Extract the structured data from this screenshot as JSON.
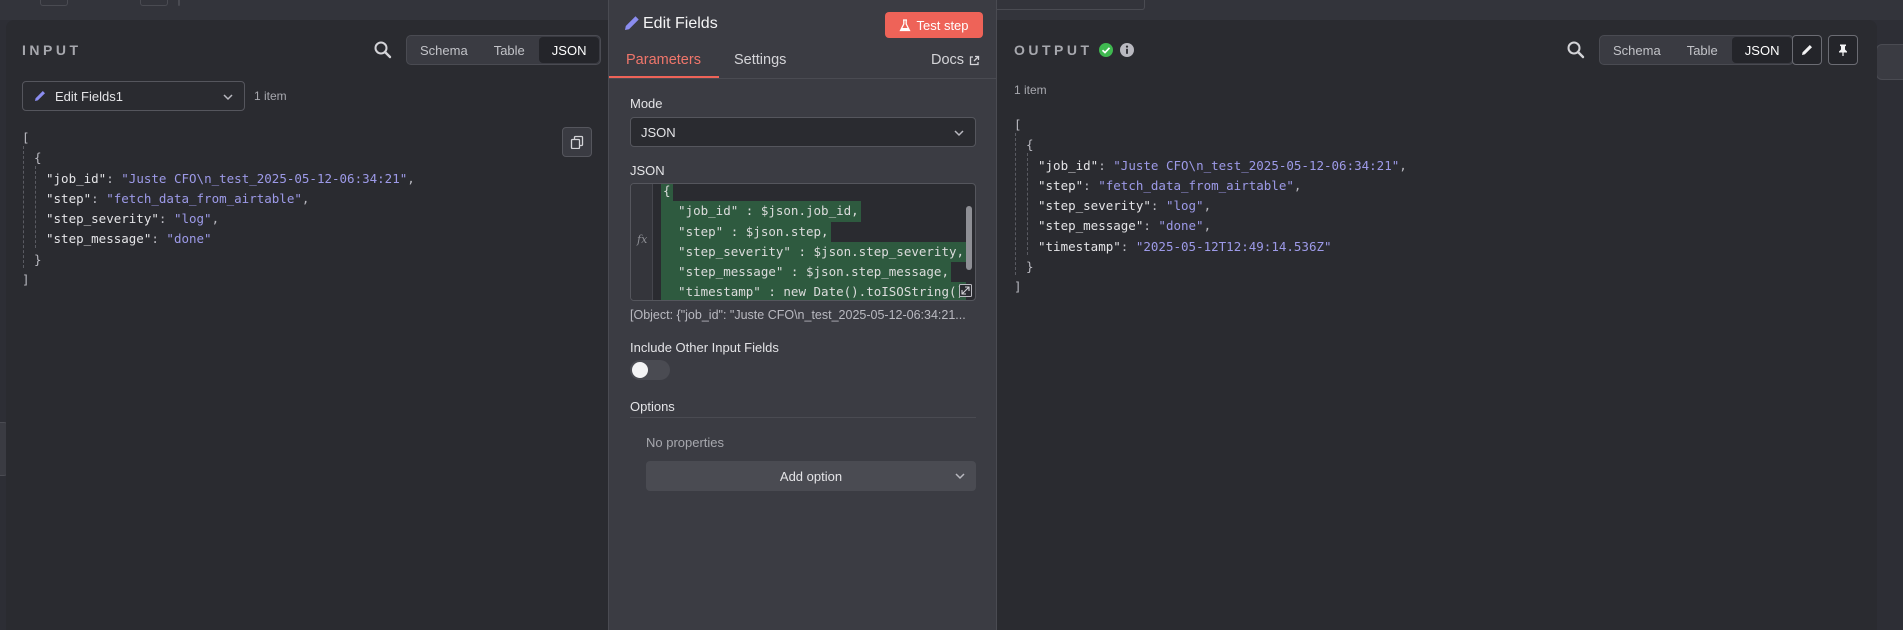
{
  "input": {
    "title": "INPUT",
    "view_modes": [
      "Schema",
      "Table",
      "JSON"
    ],
    "active_mode": "JSON",
    "node_select": "Edit Fields1",
    "item_count": "1 item",
    "json": {
      "open_array": "[",
      "open_obj": "{",
      "fields": [
        {
          "key": "\"job_id\"",
          "value": "\"Juste CFO\\n_test_2025-05-12-06:34:21\"",
          "comma": true
        },
        {
          "key": "\"step\"",
          "value": "\"fetch_data_from_airtable\"",
          "comma": true
        },
        {
          "key": "\"step_severity\"",
          "value": "\"log\"",
          "comma": true
        },
        {
          "key": "\"step_message\"",
          "value": "\"done\"",
          "comma": false
        }
      ],
      "close_obj": "}",
      "close_array": "]"
    }
  },
  "node": {
    "title": "Edit Fields",
    "test_button": "Test step",
    "tabs": [
      "Parameters",
      "Settings"
    ],
    "docs_link": "Docs",
    "mode_label": "Mode",
    "mode_value": "JSON",
    "json_label": "JSON",
    "fx_label": "fx",
    "code_lines": [
      "{",
      "  \"job_id\" : $json.job_id,",
      "  \"step\" : $json.step,",
      "  \"step_severity\" : $json.step_severity,",
      "  \"step_message\" : $json.step_message,",
      "  \"timestamp\" : new Date().toISOString()"
    ],
    "preview": "[Object: {\"job_id\": \"Juste CFO\\n_test_2025-05-12-06:34:21...",
    "include_label": "Include Other Input Fields",
    "include_on": false,
    "options_label": "Options",
    "no_properties": "No properties",
    "add_option": "Add option"
  },
  "output": {
    "title": "OUTPUT",
    "view_modes": [
      "Schema",
      "Table",
      "JSON"
    ],
    "active_mode": "JSON",
    "item_count": "1 item",
    "json": {
      "open_array": "[",
      "open_obj": "{",
      "fields": [
        {
          "key": "\"job_id\"",
          "value": "\"Juste CFO\\n_test_2025-05-12-06:34:21\"",
          "comma": true
        },
        {
          "key": "\"step\"",
          "value": "\"fetch_data_from_airtable\"",
          "comma": true
        },
        {
          "key": "\"step_severity\"",
          "value": "\"log\"",
          "comma": true
        },
        {
          "key": "\"step_message\"",
          "value": "\"done\"",
          "comma": true
        },
        {
          "key": "\"timestamp\"",
          "value": "\"2025-05-12T12:49:14.536Z\"",
          "comma": false
        }
      ],
      "close_obj": "}",
      "close_array": "]"
    }
  },
  "colors": {
    "accent": "#ee6358",
    "json_value": "#9d9ae8",
    "success": "#3fb950",
    "code_highlight": "#2e5a3f"
  },
  "icons": {
    "search": "search-icon",
    "pencil": "pencil-icon",
    "flask": "flask-icon",
    "external": "external-link-icon",
    "copy": "copy-icon",
    "check": "check-circle-icon",
    "info": "info-icon",
    "pin": "pin-icon",
    "chevron": "chevron-down-icon"
  }
}
